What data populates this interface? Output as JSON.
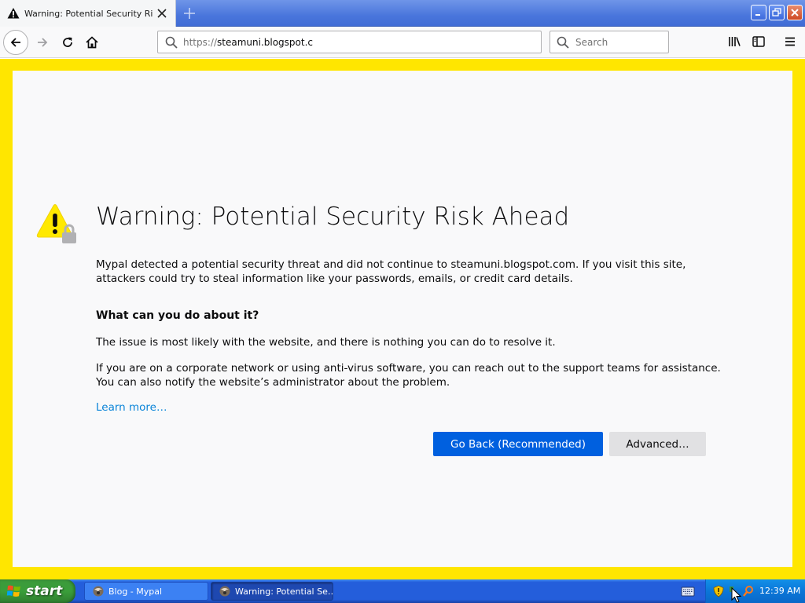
{
  "browser": {
    "tab": {
      "title": "Warning: Potential Security Risk Ahead",
      "icon": "warning-icon"
    },
    "new_tab_icon": "plus-icon",
    "window_controls": [
      "minimize-icon",
      "restore-icon",
      "close-icon"
    ],
    "toolbar": {
      "back_icon": "arrow-left-icon",
      "forward_icon": "arrow-right-icon",
      "reload_icon": "reload-icon",
      "home_icon": "home-icon",
      "url": {
        "protocol": "https://",
        "host": "steamuni.blogspot.c"
      },
      "search_placeholder": "Search",
      "library_icon": "library-icon",
      "sidebar_icon": "sidebar-icon",
      "menu_icon": "hamburger-menu-icon"
    }
  },
  "error_page": {
    "title": "Warning: Potential Security Risk Ahead",
    "intro": "Mypal detected a potential security threat and did not continue to steamuni.blogspot.com. If you visit this site, attackers could try to steal information like your passwords, emails, or credit card details.",
    "what_heading": "What can you do about it?",
    "issue_text": "The issue is most likely with the website, and there is nothing you can do to resolve it.",
    "corp_text": "If you are on a corporate network or using anti-virus software, you can reach out to the support teams for assistance. You can also notify the website’s administrator about the problem.",
    "learn_more": "Learn more…",
    "go_back_label": "Go Back (Recommended)",
    "advanced_label": "Advanced…"
  },
  "colors": {
    "page_border": "#ffe600",
    "primary_button": "#0060df",
    "link": "#0a84d8"
  },
  "taskbar": {
    "start_label": "start",
    "items": [
      {
        "label": "Blog - Mypal",
        "active": false
      },
      {
        "label": "Warning: Potential Se…",
        "active": true
      }
    ],
    "clock": "12:39 AM"
  }
}
